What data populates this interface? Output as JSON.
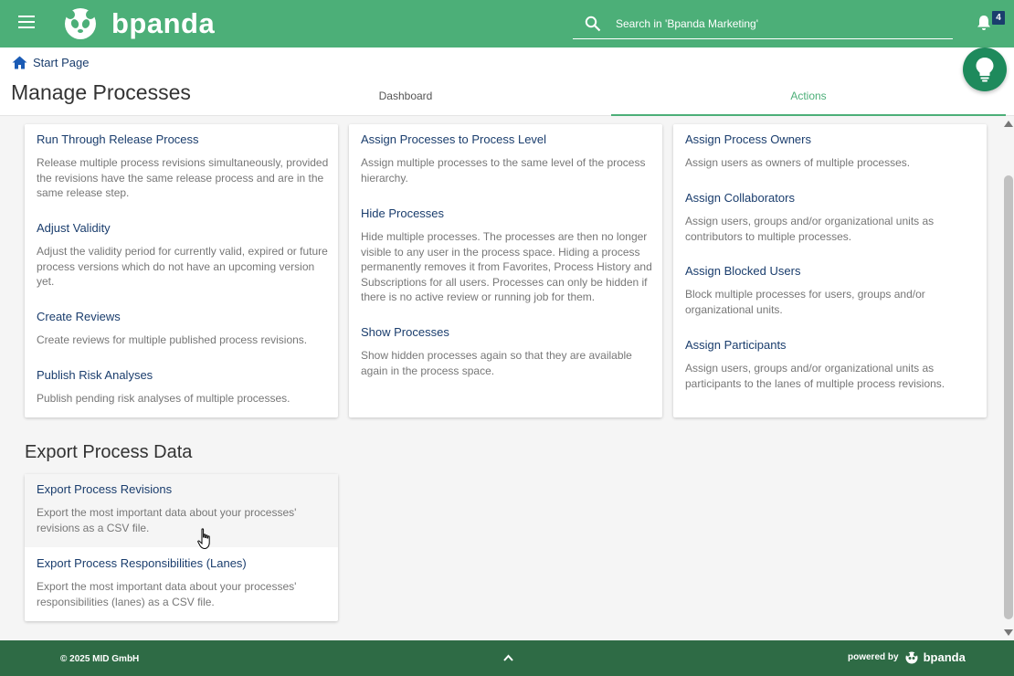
{
  "app": {
    "brand": "bpanda",
    "search_placeholder": "Search in 'Bpanda Marketing'",
    "notification_count": "4"
  },
  "header": {
    "breadcrumb": "Start Page",
    "title": "Manage Processes",
    "tabs": [
      {
        "label": "Dashboard",
        "active": false
      },
      {
        "label": "Actions",
        "active": true
      }
    ]
  },
  "cards": [
    {
      "items": [
        {
          "title": "Run Through Release Process",
          "desc": "Release multiple process revisions simultaneously, provided the revisions have the same release process and are in the same release step."
        },
        {
          "title": "Adjust Validity",
          "desc": "Adjust the validity period for currently valid, expired or future process versions which do not have an upcoming version yet."
        },
        {
          "title": "Create Reviews",
          "desc": "Create reviews for multiple published process revisions."
        },
        {
          "title": "Publish Risk Analyses",
          "desc": "Publish pending risk analyses of multiple processes."
        }
      ]
    },
    {
      "items": [
        {
          "title": "Assign Processes to Process Level",
          "desc": "Assign multiple processes to the same level of the process hierarchy."
        },
        {
          "title": "Hide Processes",
          "desc": "Hide multiple processes. The processes are then no longer visible to any user in the process space. Hiding a process permanently removes it from Favorites, Process History and Subscriptions for all users. Processes can only be hidden if there is no active review or running job for them."
        },
        {
          "title": "Show Processes",
          "desc": "Show hidden processes again so that they are available again in the process space."
        }
      ]
    },
    {
      "items": [
        {
          "title": "Assign Process Owners",
          "desc": "Assign users as owners of multiple processes."
        },
        {
          "title": "Assign Collaborators",
          "desc": "Assign users, groups and/or organizational units as contributors to multiple processes."
        },
        {
          "title": "Assign Blocked Users",
          "desc": "Block multiple processes for users, groups and/or organizational units."
        },
        {
          "title": "Assign Participants",
          "desc": "Assign users, groups and/or organizational units as participants to the lanes of multiple process revisions."
        }
      ]
    }
  ],
  "export": {
    "title": "Export Process Data",
    "items": [
      {
        "title": "Export Process Revisions",
        "desc": "Export the most important data about your processes' revisions as a CSV file."
      },
      {
        "title": "Export Process Responsibilities (Lanes)",
        "desc": "Export the most important data about your processes' responsibilities (lanes) as a CSV file."
      }
    ]
  },
  "footer": {
    "copyright": "© 2025 MID GmbH",
    "powered_by": "powered by",
    "brand": "bpanda"
  },
  "colors": {
    "primary": "#4caf78",
    "footer": "#2e6b45",
    "link": "#1a3d6d"
  }
}
